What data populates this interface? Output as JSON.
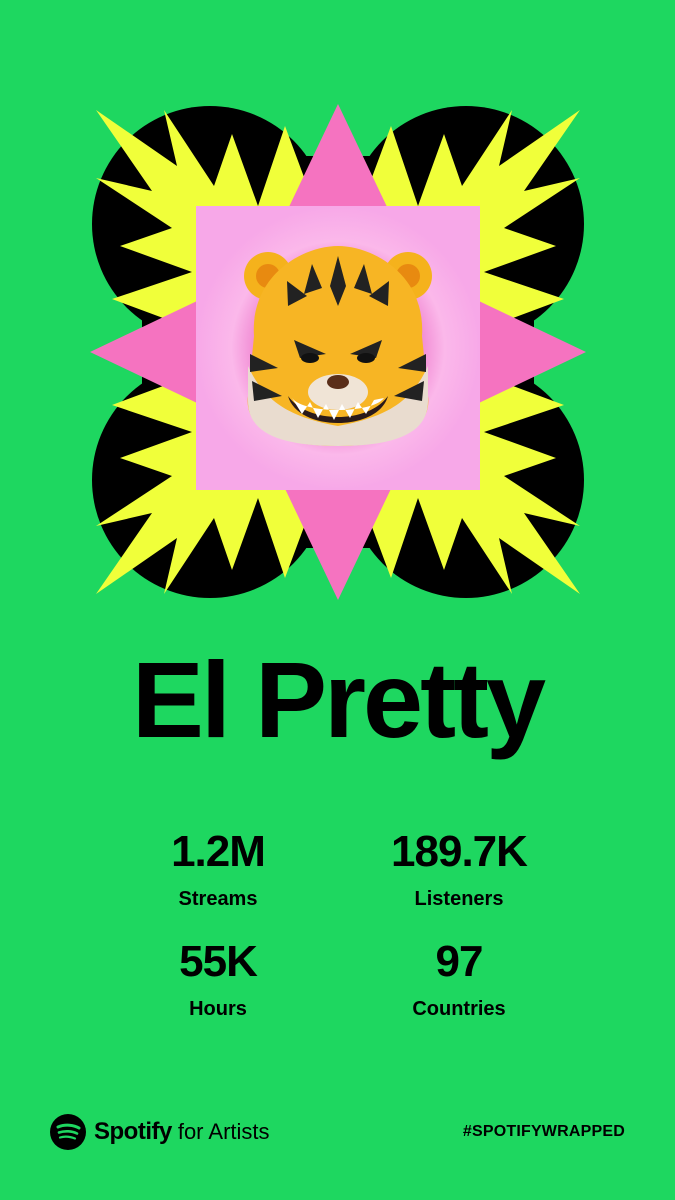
{
  "artist": {
    "name": "El Pretty"
  },
  "stats": [
    {
      "value": "1.2M",
      "label": "Streams"
    },
    {
      "value": "189.7K",
      "label": "Listeners"
    },
    {
      "value": "55K",
      "label": "Hours"
    },
    {
      "value": "97",
      "label": "Countries"
    }
  ],
  "footer": {
    "brand": "Spotify",
    "sub": "for Artists",
    "hashtag": "#SPOTIFYWRAPPED",
    "logo_icon": "spotify-logo-icon"
  },
  "artwork": {
    "icon": "tiger-emoji-avatar",
    "colors": {
      "background": "#1ED760",
      "blob": "#000000",
      "burst": "#F0FF3A",
      "diamond": "#F573C0",
      "square": "#F7A8E8"
    }
  }
}
